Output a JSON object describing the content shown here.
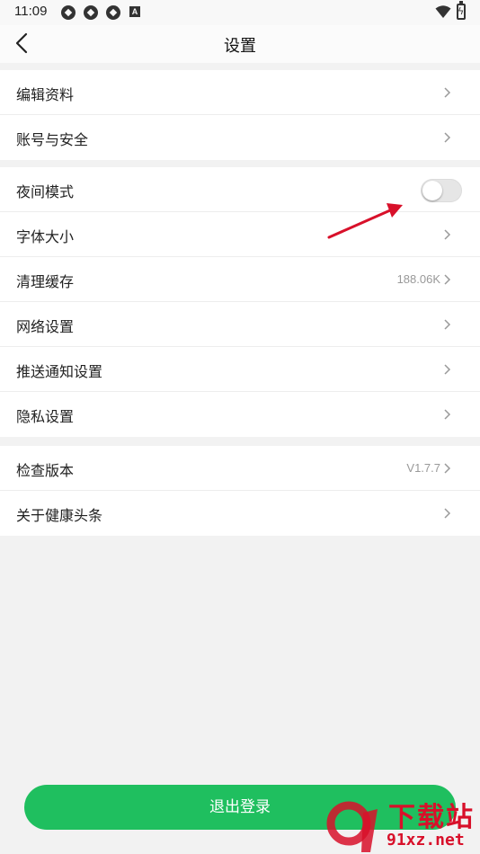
{
  "status_bar": {
    "time": "11:09",
    "notification_icons": [
      "settings-app-icon",
      "settings-app-icon",
      "settings-app-icon",
      "a-icon"
    ],
    "a_icon_text": "A"
  },
  "header": {
    "title": "设置"
  },
  "groups": [
    {
      "items": [
        {
          "label": "编辑资料",
          "value": ""
        },
        {
          "label": "账号与安全",
          "value": ""
        }
      ]
    },
    {
      "items": [
        {
          "label": "夜间模式",
          "toggle": false
        },
        {
          "label": "字体大小",
          "value": ""
        },
        {
          "label": "清理缓存",
          "value": "188.06K"
        },
        {
          "label": "网络设置",
          "value": ""
        },
        {
          "label": "推送通知设置",
          "value": ""
        },
        {
          "label": "隐私设置",
          "value": ""
        }
      ]
    },
    {
      "items": [
        {
          "label": "检查版本",
          "value": "V1.7.7"
        },
        {
          "label": "关于健康头条",
          "value": ""
        }
      ]
    }
  ],
  "logout_label": "退出登录",
  "watermark": {
    "top": "下载站",
    "bottom": "91xz.net"
  },
  "colors": {
    "accent": "#1fbf5f",
    "annotation_arrow": "#d8102a",
    "page_bg": "#f2f2f2"
  }
}
